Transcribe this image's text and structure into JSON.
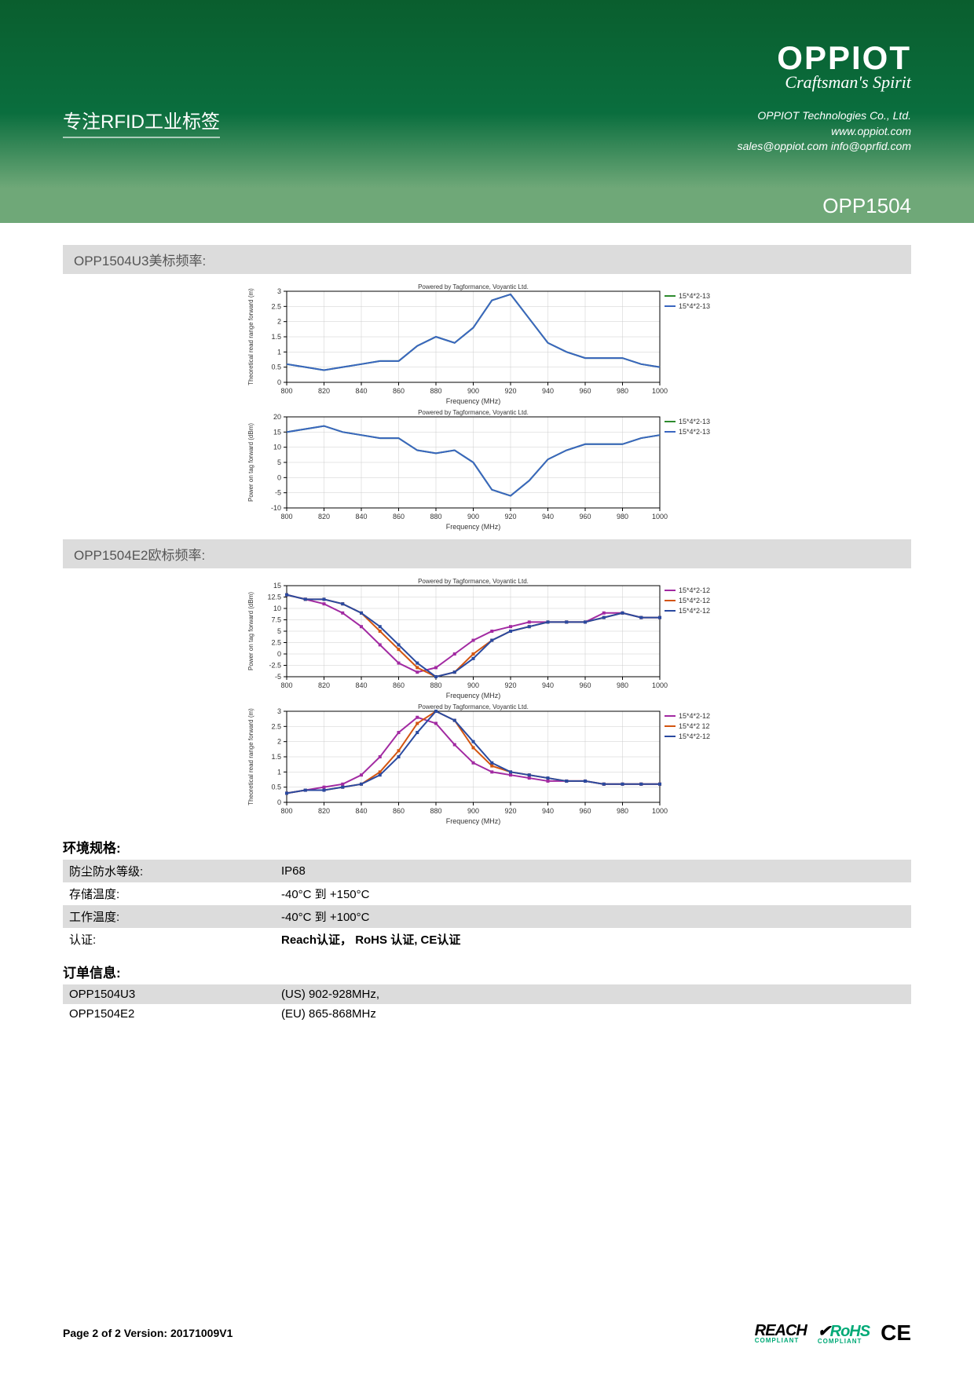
{
  "header": {
    "logo": "OPPIOT",
    "tagline": "Craftsman's Spirit",
    "company": "OPPIOT Technologies Co., Ltd.",
    "website": "www.oppiot.com",
    "emails": "sales@oppiot.com  info@oprfid.com",
    "left_title": "专注RFID工业标签",
    "product": "OPP1504"
  },
  "sections": {
    "chart1_title": "OPP1504U3美标频率:",
    "chart2_title": "OPP1504E2欧标频率:",
    "env_title": "环境规格:",
    "order_title": "订单信息:"
  },
  "env_specs": [
    {
      "label": "防尘防水等级:",
      "value": "IP68",
      "gray": true
    },
    {
      "label": "存储温度:",
      "value": "-40°C 到 +150°C",
      "gray": false
    },
    {
      "label": "工作温度:",
      "value": "-40°C 到 +100°C",
      "gray": true
    },
    {
      "label": "认证:",
      "value": "Reach认证， RoHS 认证, CE认证",
      "gray": false
    }
  ],
  "order_info": [
    {
      "label": "OPP1504U3",
      "value": "(US) 902-928MHz,",
      "gray": true
    },
    {
      "label": "OPP1504E2",
      "value": "(EU) 865-868MHz",
      "gray": false
    }
  ],
  "footer": {
    "pageinfo": "Page 2 of 2  Version: 20171009V1",
    "reach": "REACH",
    "rohs": "RoHS",
    "compliant": "COMPLIANT",
    "ce": "CE"
  },
  "chart_data": [
    {
      "type": "line",
      "title": "Powered by Tagformance, Voyantic Ltd.",
      "xlabel": "Frequency (MHz)",
      "ylabel": "Theoretical read range forward (m)",
      "xlim": [
        800,
        1000
      ],
      "ylim": [
        0,
        3
      ],
      "xticks": [
        800,
        820,
        840,
        860,
        880,
        900,
        920,
        940,
        960,
        980,
        1000
      ],
      "yticks": [
        0,
        0.5,
        1,
        1.5,
        2,
        2.5,
        3
      ],
      "legend": [
        "15*4*2-13",
        "15*4*2-13"
      ],
      "series": [
        {
          "name": "15*4*2-13",
          "color": "#2e8b2e",
          "x": [
            800,
            810,
            820,
            830,
            840,
            850,
            860,
            870,
            880,
            890,
            900,
            910,
            920,
            930,
            940,
            950,
            960,
            970,
            980,
            990,
            1000
          ],
          "values": [
            0.6,
            0.5,
            0.4,
            0.5,
            0.6,
            0.7,
            0.7,
            1.2,
            1.5,
            1.3,
            1.8,
            2.7,
            2.9,
            2.1,
            1.3,
            1.0,
            0.8,
            0.8,
            0.8,
            0.6,
            0.5
          ]
        },
        {
          "name": "15*4*2-13",
          "color": "#3a66c0",
          "x": [
            800,
            810,
            820,
            830,
            840,
            850,
            860,
            870,
            880,
            890,
            900,
            910,
            920,
            930,
            940,
            950,
            960,
            970,
            980,
            990,
            1000
          ],
          "values": [
            0.6,
            0.5,
            0.4,
            0.5,
            0.6,
            0.7,
            0.7,
            1.2,
            1.5,
            1.3,
            1.8,
            2.7,
            2.9,
            2.1,
            1.3,
            1.0,
            0.8,
            0.8,
            0.8,
            0.6,
            0.5
          ]
        }
      ]
    },
    {
      "type": "line",
      "title": "Powered by Tagformance, Voyantic Ltd.",
      "xlabel": "Frequency (MHz)",
      "ylabel": "Power on tag forward (dBm)",
      "xlim": [
        800,
        1000
      ],
      "ylim": [
        -10,
        20
      ],
      "xticks": [
        800,
        820,
        840,
        860,
        880,
        900,
        920,
        940,
        960,
        980,
        1000
      ],
      "yticks": [
        -10,
        -5,
        0,
        5,
        10,
        15,
        20
      ],
      "legend": [
        "15*4*2-13",
        "15*4*2-13"
      ],
      "series": [
        {
          "name": "15*4*2-13",
          "color": "#2e8b2e",
          "x": [
            800,
            810,
            820,
            830,
            840,
            850,
            860,
            870,
            880,
            890,
            900,
            910,
            920,
            930,
            940,
            950,
            960,
            970,
            980,
            990,
            1000
          ],
          "values": [
            15,
            16,
            17,
            15,
            14,
            13,
            13,
            9,
            8,
            9,
            5,
            -4,
            -6,
            -1,
            6,
            9,
            11,
            11,
            11,
            13,
            14
          ]
        },
        {
          "name": "15*4*2-13",
          "color": "#3a66c0",
          "x": [
            800,
            810,
            820,
            830,
            840,
            850,
            860,
            870,
            880,
            890,
            900,
            910,
            920,
            930,
            940,
            950,
            960,
            970,
            980,
            990,
            1000
          ],
          "values": [
            15,
            16,
            17,
            15,
            14,
            13,
            13,
            9,
            8,
            9,
            5,
            -4,
            -6,
            -1,
            6,
            9,
            11,
            11,
            11,
            13,
            14
          ]
        }
      ]
    },
    {
      "type": "line",
      "title": "Powered by Tagformance, Voyantic Ltd.",
      "xlabel": "Frequency (MHz)",
      "ylabel": "Power on tag forward (dBm)",
      "xlim": [
        800,
        1000
      ],
      "ylim": [
        -5,
        15
      ],
      "xticks": [
        800,
        820,
        840,
        860,
        880,
        900,
        920,
        940,
        960,
        980,
        1000
      ],
      "yticks": [
        -5,
        -2.5,
        0,
        2.5,
        5,
        7.5,
        10,
        12.5,
        15
      ],
      "legend": [
        "15*4*2-12",
        "15*4*2-12",
        "15*4*2-12"
      ],
      "series": [
        {
          "name": "15*4*2-12",
          "color": "#a22aa2",
          "x": [
            800,
            810,
            820,
            830,
            840,
            850,
            860,
            870,
            880,
            890,
            900,
            910,
            920,
            930,
            940,
            950,
            960,
            970,
            980,
            990,
            1000
          ],
          "values": [
            13,
            12,
            11,
            9,
            6,
            2,
            -2,
            -4,
            -3,
            0,
            3,
            5,
            6,
            7,
            7,
            7,
            7,
            9,
            9,
            8,
            8
          ]
        },
        {
          "name": "15*4*2-12",
          "color": "#d35510",
          "x": [
            800,
            810,
            820,
            830,
            840,
            850,
            860,
            870,
            880,
            890,
            900,
            910,
            920,
            930,
            940,
            950,
            960,
            970,
            980,
            990,
            1000
          ],
          "values": [
            13,
            12,
            12,
            11,
            9,
            5,
            1,
            -3,
            -5,
            -4,
            0,
            3,
            5,
            6,
            7,
            7,
            7,
            8,
            9,
            8,
            8
          ]
        },
        {
          "name": "15*4*2-12",
          "color": "#2a4aa0",
          "x": [
            800,
            810,
            820,
            830,
            840,
            850,
            860,
            870,
            880,
            890,
            900,
            910,
            920,
            930,
            940,
            950,
            960,
            970,
            980,
            990,
            1000
          ],
          "values": [
            13,
            12,
            12,
            11,
            9,
            6,
            2,
            -2,
            -5,
            -4,
            -1,
            3,
            5,
            6,
            7,
            7,
            7,
            8,
            9,
            8,
            8
          ]
        }
      ]
    },
    {
      "type": "line",
      "title": "Powered by Tagformance, Voyantic Ltd.",
      "xlabel": "Frequency (MHz)",
      "ylabel": "Theoretical read range forward (m)",
      "xlim": [
        800,
        1000
      ],
      "ylim": [
        0,
        3
      ],
      "xticks": [
        800,
        820,
        840,
        860,
        880,
        900,
        920,
        940,
        960,
        980,
        1000
      ],
      "yticks": [
        0,
        0.5,
        1,
        1.5,
        2,
        2.5,
        3
      ],
      "legend": [
        "15*4*2-12",
        "15*4*2 12",
        "15*4*2-12"
      ],
      "series": [
        {
          "name": "15*4*2-12",
          "color": "#a22aa2",
          "x": [
            800,
            810,
            820,
            830,
            840,
            850,
            860,
            870,
            880,
            890,
            900,
            910,
            920,
            930,
            940,
            950,
            960,
            970,
            980,
            990,
            1000
          ],
          "values": [
            0.3,
            0.4,
            0.5,
            0.6,
            0.9,
            1.5,
            2.3,
            2.8,
            2.6,
            1.9,
            1.3,
            1.0,
            0.9,
            0.8,
            0.7,
            0.7,
            0.7,
            0.6,
            0.6,
            0.6,
            0.6
          ]
        },
        {
          "name": "15*4*2-12",
          "color": "#d35510",
          "x": [
            800,
            810,
            820,
            830,
            840,
            850,
            860,
            870,
            880,
            890,
            900,
            910,
            920,
            930,
            940,
            950,
            960,
            970,
            980,
            990,
            1000
          ],
          "values": [
            0.3,
            0.4,
            0.4,
            0.5,
            0.6,
            1.0,
            1.7,
            2.6,
            3.0,
            2.7,
            1.8,
            1.2,
            1.0,
            0.9,
            0.8,
            0.7,
            0.7,
            0.6,
            0.6,
            0.6,
            0.6
          ]
        },
        {
          "name": "15*4*2-12",
          "color": "#2a4aa0",
          "x": [
            800,
            810,
            820,
            830,
            840,
            850,
            860,
            870,
            880,
            890,
            900,
            910,
            920,
            930,
            940,
            950,
            960,
            970,
            980,
            990,
            1000
          ],
          "values": [
            0.3,
            0.4,
            0.4,
            0.5,
            0.6,
            0.9,
            1.5,
            2.3,
            3.0,
            2.7,
            2.0,
            1.3,
            1.0,
            0.9,
            0.8,
            0.7,
            0.7,
            0.6,
            0.6,
            0.6,
            0.6
          ]
        }
      ]
    }
  ]
}
